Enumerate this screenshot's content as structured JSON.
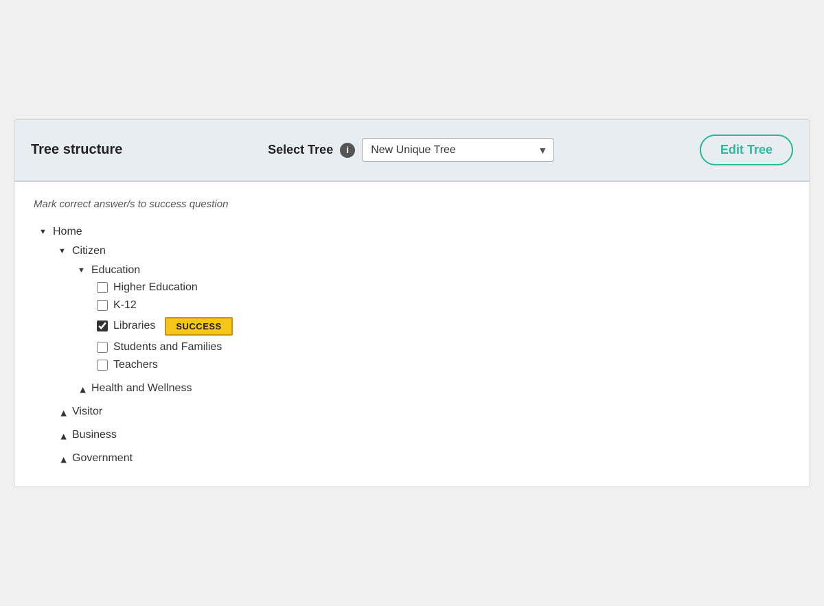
{
  "header": {
    "title": "Tree structure",
    "select_tree_label": "Select Tree",
    "info_icon_label": "i",
    "tree_options": [
      "New Unique Tree"
    ],
    "tree_selected": "New Unique Tree",
    "edit_tree_label": "Edit Tree"
  },
  "content": {
    "instruction": "Mark correct answer/s to success question",
    "tree": {
      "home": {
        "label": "Home",
        "children": {
          "citizen": {
            "label": "Citizen",
            "children": {
              "education": {
                "label": "Education",
                "children": [
                  {
                    "label": "Higher Education",
                    "checked": false,
                    "success": false
                  },
                  {
                    "label": "K-12",
                    "checked": false,
                    "success": false
                  },
                  {
                    "label": "Libraries",
                    "checked": true,
                    "success": true
                  },
                  {
                    "label": "Students and Families",
                    "checked": false,
                    "success": false
                  },
                  {
                    "label": "Teachers",
                    "checked": false,
                    "success": false
                  }
                ]
              },
              "health_and_wellness": {
                "label": "Health and Wellness",
                "collapsed": true
              }
            }
          },
          "visitor": {
            "label": "Visitor",
            "collapsed": true
          },
          "business": {
            "label": "Business",
            "collapsed": true
          },
          "government": {
            "label": "Government",
            "collapsed": true
          }
        }
      }
    },
    "success_badge_label": "SUCCESS"
  }
}
